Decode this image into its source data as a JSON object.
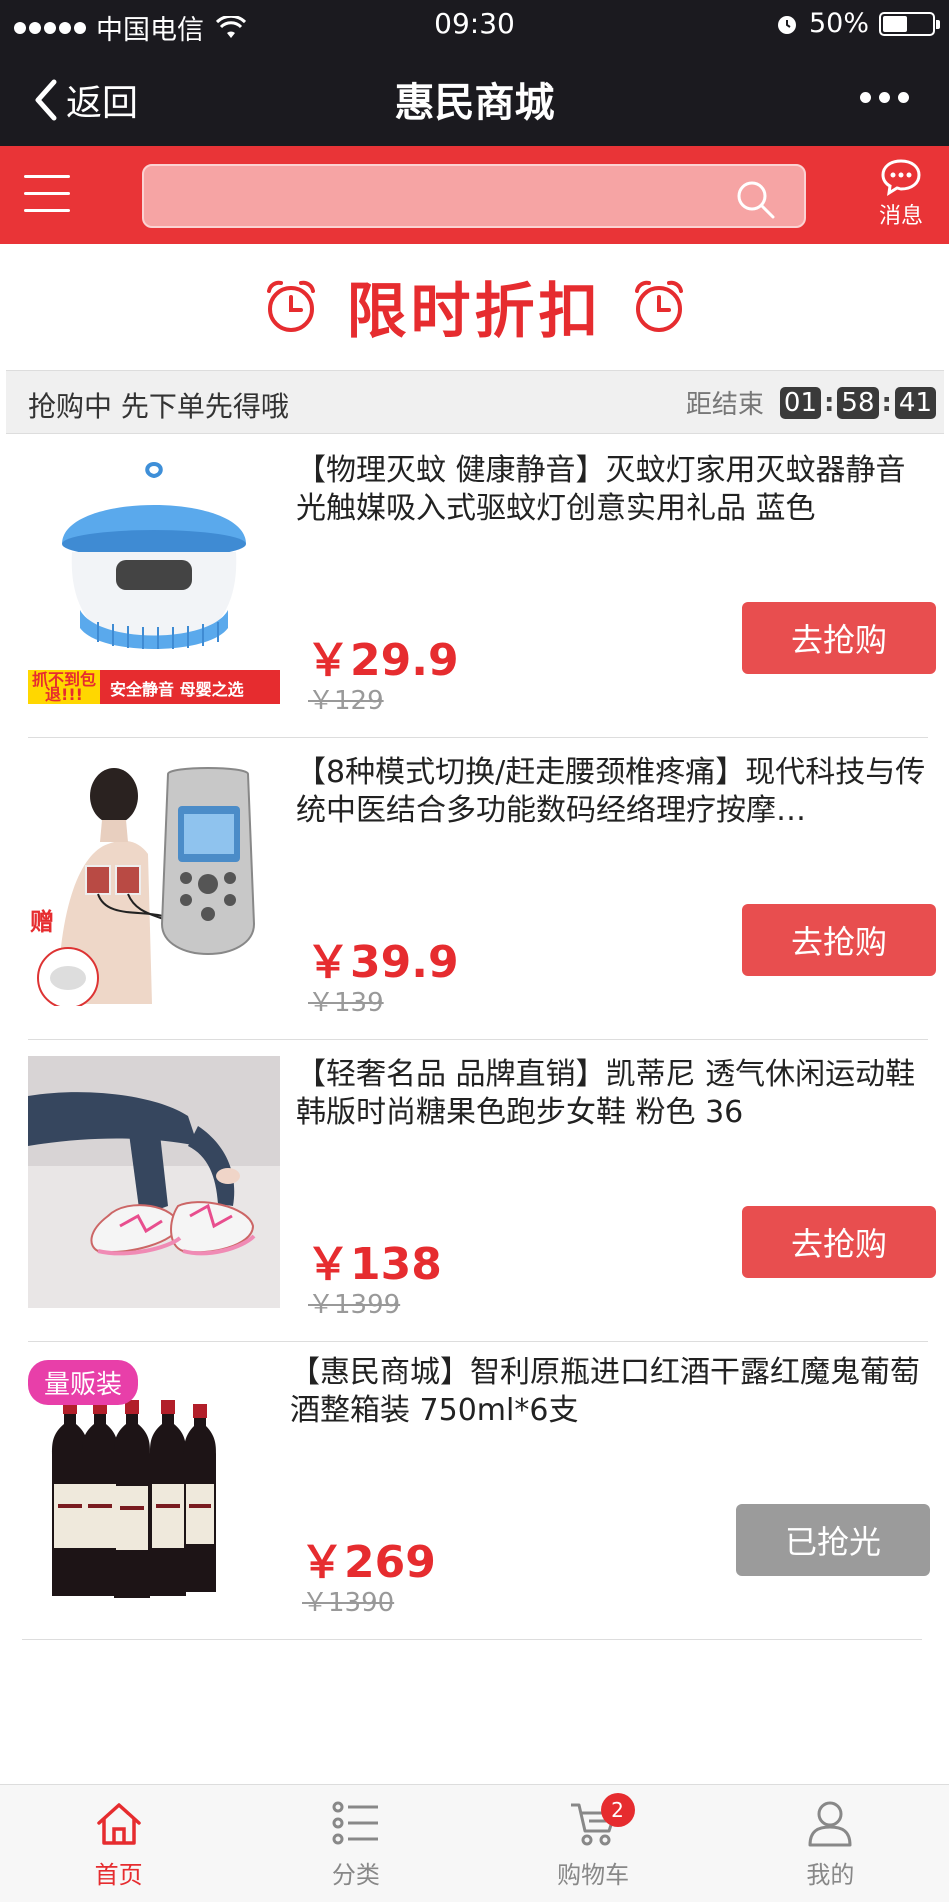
{
  "status_bar": {
    "carrier": "中国电信",
    "time": "09:30",
    "battery": "50%"
  },
  "nav": {
    "back_label": "返回",
    "title": "惠民商城"
  },
  "search": {
    "placeholder": "",
    "message_label": "消息"
  },
  "banner": {
    "title": "限时折扣"
  },
  "countdown": {
    "promo_text": "抢购中 先下单先得哦",
    "label": "距结束",
    "hours": "01",
    "minutes": "58",
    "seconds": "41"
  },
  "products": [
    {
      "title": "【物理灭蚊 健康静音】灭蚊灯家用灭蚊器静音光触媒吸入式驱蚊灯创意实用礼品 蓝色",
      "price": "￥29.9",
      "original_price": "￥129",
      "button": "去抢购",
      "sticker_left": "抓不到包退!!!",
      "sticker_right": "安全静音 母婴之选"
    },
    {
      "title": "【8种模式切换/赶走腰颈椎疼痛】现代科技与传统中医结合多功能数码经络理疗按摩…",
      "price": "￥39.9",
      "original_price": "￥139",
      "button": "去抢购",
      "gift_label": "赠"
    },
    {
      "title": "【轻奢名品 品牌直销】凯蒂尼 透气休闲运动鞋韩版时尚糖果色跑步女鞋 粉色 36",
      "price": "￥138",
      "original_price": "￥1399",
      "button": "去抢购"
    },
    {
      "title": "【惠民商城】智利原瓶进口红酒干露红魔鬼葡萄酒整箱装 750ml*6支",
      "price": "￥269",
      "original_price": "￥1390",
      "button": "已抢光",
      "tag": "量贩装"
    }
  ],
  "tabs": [
    {
      "label": "首页",
      "icon": "home-icon",
      "active": true
    },
    {
      "label": "分类",
      "icon": "list-icon",
      "active": false
    },
    {
      "label": "购物车",
      "icon": "cart-icon",
      "active": false,
      "badge": "2"
    },
    {
      "label": "我的",
      "icon": "user-icon",
      "active": false
    }
  ],
  "colors": {
    "accent": "#e62c2f",
    "header_bg": "#1b1a1f",
    "search_bg": "#e93437",
    "button_red": "#e84e4f",
    "button_sold": "#9b9b9b"
  }
}
